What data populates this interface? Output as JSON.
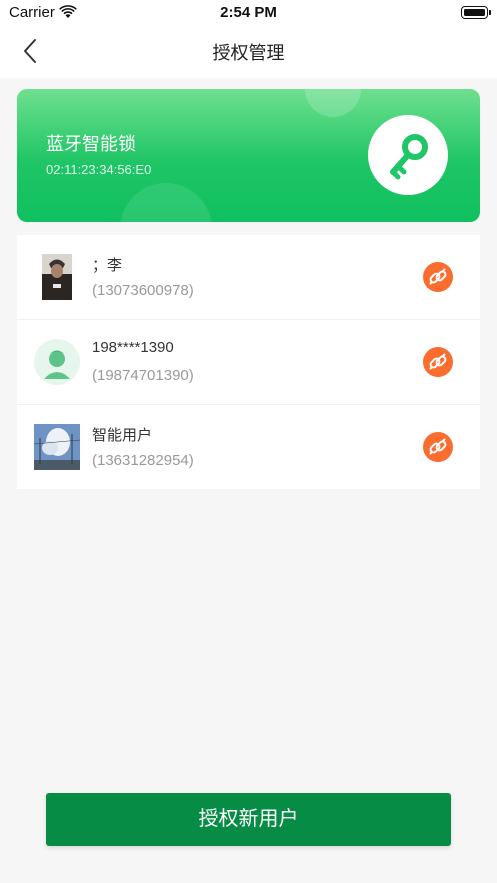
{
  "status_bar": {
    "carrier": "Carrier",
    "time": "2:54 PM"
  },
  "nav": {
    "title": "授权管理",
    "back_icon": "chevron-left-icon"
  },
  "device": {
    "name": "蓝牙智能锁",
    "mac": "02:11:23:34:56:E0",
    "icon": "key-icon"
  },
  "users": [
    {
      "name": "；李",
      "phone": "(13073600978)",
      "avatar": "photo-person"
    },
    {
      "name": "198****1390",
      "phone": "(19874701390)",
      "avatar": "default-avatar"
    },
    {
      "name": "智能用户",
      "phone": "(13631282954)",
      "avatar": "photo-landscape"
    }
  ],
  "actions": {
    "unbind_icon": "unlink-icon",
    "add_user_label": "授权新用户"
  },
  "colors": {
    "accent_green": "#078c45",
    "card_green_top": "#6fe08f",
    "card_green_bottom": "#10c060",
    "unbind_orange": "#fb6d2f"
  }
}
